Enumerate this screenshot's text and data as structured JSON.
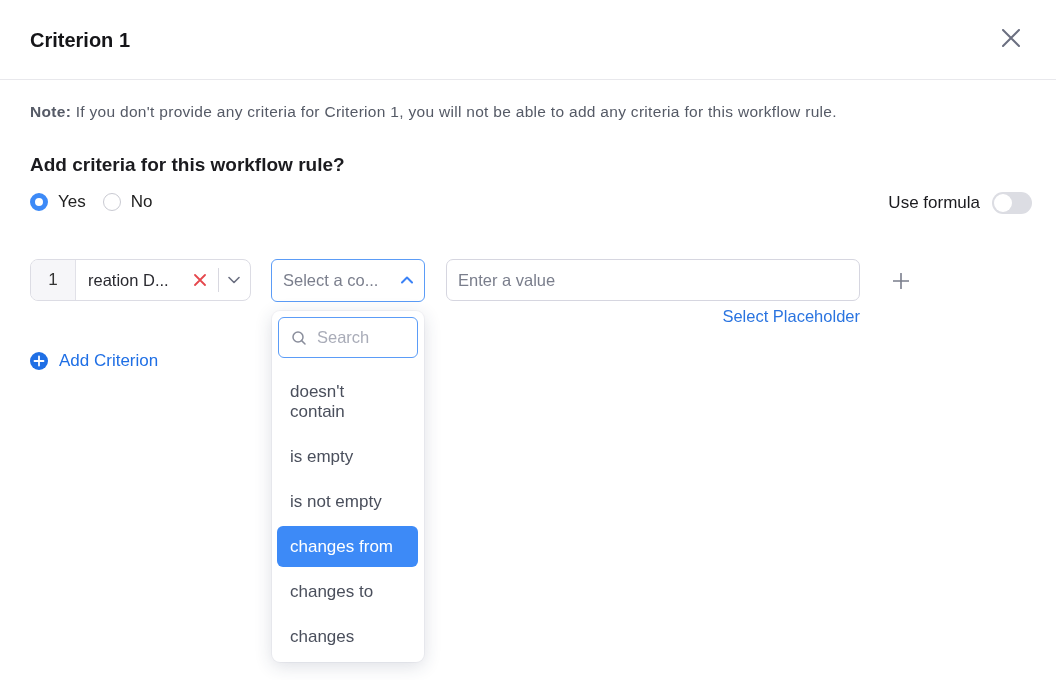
{
  "dialog": {
    "title": "Criterion 1"
  },
  "note": "**Note:** If you don't provide any criteria for Criterion 1, you will not be able to add any criteria for this workflow rule.",
  "question": "Add criteria for this workflow rule?",
  "options": [
    {
      "label": "Yes",
      "selected": true
    },
    {
      "label": "No",
      "selected": false
    }
  ],
  "use_formula": {
    "label": "Use formula",
    "on": false
  },
  "criteria": [
    {
      "index": "1",
      "field": "reation D...",
      "condition": {
        "placeholder": "Select a co...",
        "expanded": true
      },
      "value": {
        "placeholder": "Enter a value"
      },
      "placeholder_link": "Select Placeholder"
    }
  ],
  "condition_menu": {
    "search": {
      "placeholder": "Search"
    },
    "items": [
      {
        "label": "doesn't contain",
        "selected": false
      },
      {
        "label": "is empty",
        "selected": false
      },
      {
        "label": "is not empty",
        "selected": false
      },
      {
        "label": "changes from",
        "selected": true
      },
      {
        "label": "changes to",
        "selected": false
      },
      {
        "label": "changes",
        "selected": false
      }
    ]
  },
  "add_criterion": "Add Criterion"
}
